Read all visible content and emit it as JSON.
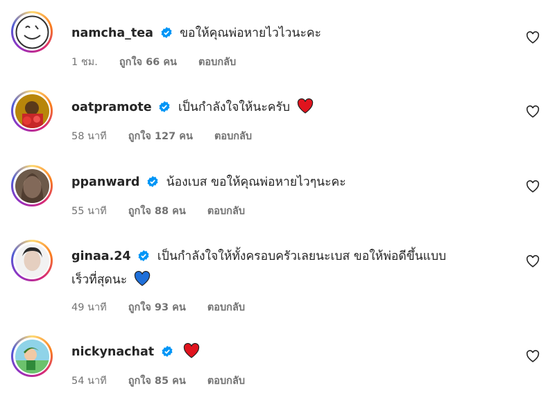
{
  "comments": [
    {
      "username": "namcha_tea",
      "text": "ขอให้คุณพ่อหายไวไวนะคะ",
      "time": "1 ชม.",
      "likes": "ถูกใจ 66 คน",
      "reply": "ตอบกลับ",
      "emoji": ""
    },
    {
      "username": "oatpramote",
      "text": "เป็นกำลังใจให้นะครับ",
      "time": "58 นาที",
      "likes": "ถูกใจ 127 คน",
      "reply": "ตอบกลับ",
      "emoji": "red-heart"
    },
    {
      "username": "ppanward",
      "text": "น้องเบส ขอให้คุณพ่อหายไวๆนะคะ",
      "time": "55 นาที",
      "likes": "ถูกใจ 88 คน",
      "reply": "ตอบกลับ",
      "emoji": ""
    },
    {
      "username": "ginaa.24",
      "text": "เป็นกำลังใจให้ทั้งครอบครัวเลยนะเบส ขอให้พ่อดีขึ้นแบบ",
      "text2": "เร็วที่สุดนะ",
      "time": "49 นาที",
      "likes": "ถูกใจ 93 คน",
      "reply": "ตอบกลับ",
      "emoji": "blue-heart"
    },
    {
      "username": "nickynachat",
      "text": "",
      "time": "54 นาที",
      "likes": "ถูกใจ 85 คน",
      "reply": "ตอบกลับ",
      "emoji": "red-heart"
    }
  ]
}
